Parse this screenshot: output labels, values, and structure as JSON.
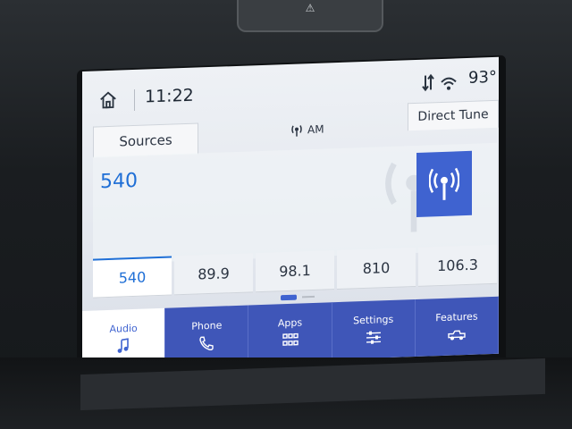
{
  "status": {
    "time": "11:22",
    "temperature": "93°"
  },
  "source": {
    "sources_label": "Sources",
    "band": "AM",
    "direct_tune_label": "Direct Tune",
    "current_frequency": "540"
  },
  "presets": [
    {
      "label": "540",
      "active": true
    },
    {
      "label": "89.9",
      "active": false
    },
    {
      "label": "98.1",
      "active": false
    },
    {
      "label": "810",
      "active": false
    },
    {
      "label": "106.3",
      "active": false
    }
  ],
  "tabs": [
    {
      "label": "Audio",
      "icon": "music-note-icon",
      "active": true
    },
    {
      "label": "Phone",
      "icon": "phone-icon",
      "active": false
    },
    {
      "label": "Apps",
      "icon": "apps-grid-icon",
      "active": false
    },
    {
      "label": "Settings",
      "icon": "sliders-icon",
      "active": false
    },
    {
      "label": "Features",
      "icon": "truck-icon",
      "active": false
    }
  ],
  "colors": {
    "accent": "#3f63d0",
    "tab_bar": "#3f56b8",
    "frequency_text": "#1f6fd6"
  }
}
